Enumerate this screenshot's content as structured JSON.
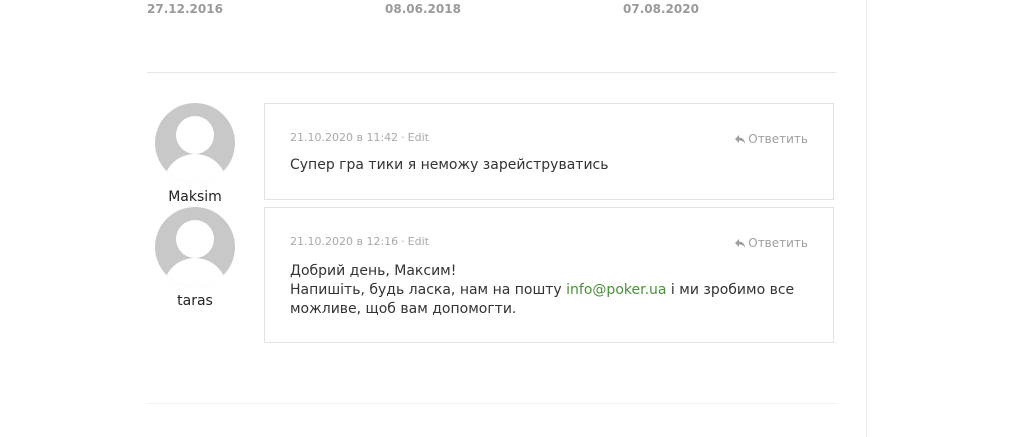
{
  "top_dates": [
    "27.12.2016",
    "08.06.2018",
    "07.08.2020"
  ],
  "comments": [
    {
      "author": "Maksim",
      "date": "21.10.2020 в 11:42",
      "edit_label": "Edit",
      "reply_label": "Ответить",
      "text": "Супер гра тики я неможу зарейструватись"
    },
    {
      "author": "taras",
      "date": "21.10.2020 в 12:16",
      "edit_label": "Edit",
      "reply_label": "Ответить",
      "lines": {
        "line1": "Добрий день, Максим!",
        "line2_before": "Напишіть, будь ласка, нам на пошту ",
        "email": "info@poker.ua",
        "line2_after": " і ми зробимо все",
        "line3": "можливе, щоб вам допомогти."
      }
    }
  ],
  "colors": {
    "link": "#4a8f3a",
    "meta": "#a8a8a8",
    "avatar": "#c8c8c8",
    "border": "#e2e2e2"
  },
  "icons": {
    "avatar": "default-user-avatar-icon",
    "reply": "reply-arrow-icon"
  }
}
